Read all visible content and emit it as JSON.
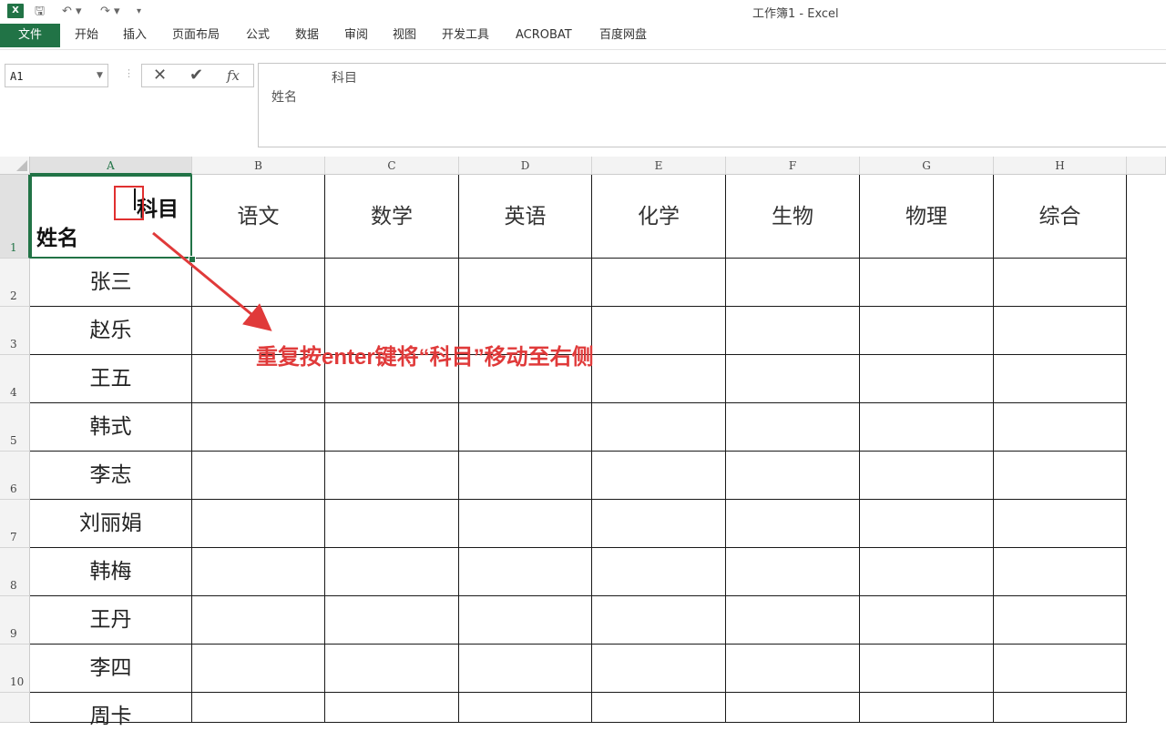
{
  "window": {
    "title": "工作簿1 - Excel",
    "app_icon_label": "X"
  },
  "quick_access": {
    "save": "🖫",
    "undo": "↶ ▾",
    "redo": "↷ ▾",
    "customize": "▾"
  },
  "ribbon": {
    "file_tab": "文件",
    "tabs": [
      "开始",
      "插入",
      "页面布局",
      "公式",
      "数据",
      "审阅",
      "视图",
      "开发工具",
      "ACROBAT",
      "百度网盘"
    ]
  },
  "formula_bar": {
    "name_box": "A1",
    "cancel_symbol": "✕",
    "enter_symbol": "✔",
    "fx_symbol": "fx",
    "content_line1": "科目",
    "content_line2": "姓名"
  },
  "grid": {
    "columns": [
      "A",
      "B",
      "C",
      "D",
      "E",
      "F",
      "G",
      "H"
    ],
    "rows": [
      "1",
      "2",
      "3",
      "4",
      "5",
      "6",
      "7",
      "8",
      "9",
      "10"
    ],
    "a1_top": "科目",
    "a1_bottom": "姓名",
    "headers": [
      "语文",
      "数学",
      "英语",
      "化学",
      "生物",
      "物理",
      "综合"
    ],
    "names": [
      "张三",
      "赵乐",
      "王五",
      "韩式",
      "李志",
      "刘丽娟",
      "韩梅",
      "王丹",
      "李四",
      "周卡"
    ]
  },
  "annotation": "重复按enter键将“科目”移动至右侧",
  "colors": {
    "excel_green": "#217346",
    "annotation_red": "#e03a3a"
  }
}
